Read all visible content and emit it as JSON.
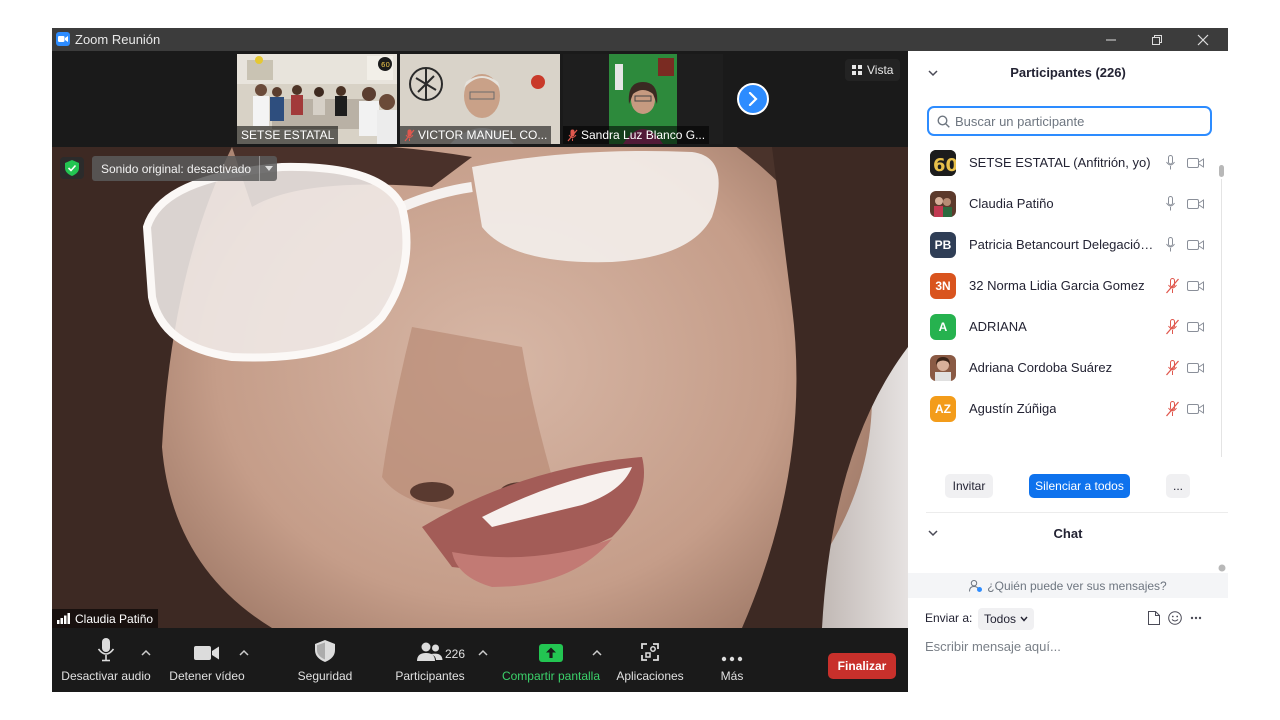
{
  "window": {
    "title": "Zoom Reunión"
  },
  "strip": {
    "tiles": [
      {
        "name": "SETSE ESTATAL",
        "muted": false
      },
      {
        "name": "VICTOR MANUEL CO...",
        "muted": true
      },
      {
        "name": "Sandra Luz Blanco G...",
        "muted": true
      }
    ],
    "view_label": "Vista"
  },
  "video": {
    "sound_label": "Sonido original: desactivado",
    "speaker": "Claudia Patiño"
  },
  "toolbar": {
    "audio_label": "Desactivar audio",
    "video_label": "Detener vídeo",
    "security_label": "Seguridad",
    "participants_label": "Participantes",
    "participants_count": "226",
    "share_label": "Compartir pantalla",
    "apps_label": "Aplicaciones",
    "more_label": "Más",
    "end_label": "Finalizar"
  },
  "participants": {
    "title": "Participantes (226)",
    "search_placeholder": "Buscar un participante",
    "list": [
      {
        "name": "SETSE ESTATAL (Anfitrión, yo)",
        "initials": "60",
        "color": "#1c1c1c",
        "muted": false
      },
      {
        "name": "Claudia Patiño",
        "initials": "",
        "color": "#7a4f3a",
        "muted": false
      },
      {
        "name": "Patricia Betancourt Delegación ...",
        "initials": "PB",
        "color": "#2f3e56",
        "muted": false
      },
      {
        "name": "32 Norma Lidia Garcia Gomez",
        "initials": "3N",
        "color": "#d9541e",
        "muted": true
      },
      {
        "name": "ADRIANA",
        "initials": "A",
        "color": "#26b24f",
        "muted": true
      },
      {
        "name": "Adriana Cordoba Suárez",
        "initials": "",
        "color": "#8a5a44",
        "muted": true
      },
      {
        "name": "Agustín Zúñiga",
        "initials": "AZ",
        "color": "#f39c1a",
        "muted": true
      }
    ],
    "invite_label": "Invitar",
    "mute_all_label": "Silenciar a todos",
    "more_label": "..."
  },
  "chat": {
    "title": "Chat",
    "who_can_see": "¿Quién puede ver sus mensajes?",
    "send_to_label": "Enviar a:",
    "recipient": "Todos",
    "input_placeholder": "Escribir mensaje aquí..."
  },
  "colors": {
    "accent": "#2d8cff",
    "end": "#c8302b",
    "share": "#23c552",
    "muted": "#e0584e"
  }
}
